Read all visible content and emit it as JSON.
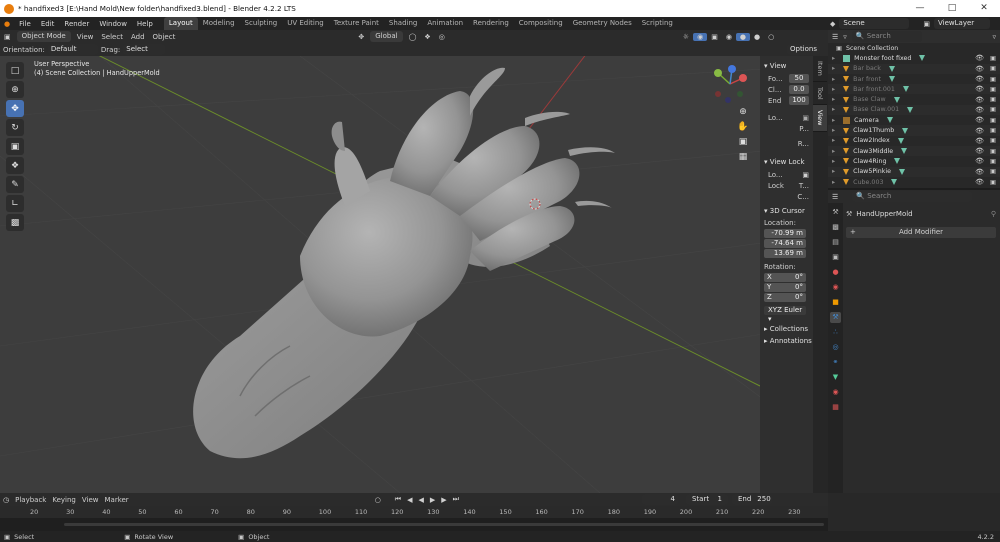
{
  "window": {
    "title": "* handfixed3 [E:\\Hand Mold\\New folder\\handfixed3.blend] - Blender 4.2.2 LTS"
  },
  "menu": [
    "File",
    "Edit",
    "Render",
    "Window",
    "Help"
  ],
  "workspaces": [
    {
      "label": "Layout",
      "active": true
    },
    {
      "label": "Modeling"
    },
    {
      "label": "Sculpting"
    },
    {
      "label": "UV Editing"
    },
    {
      "label": "Texture Paint"
    },
    {
      "label": "Shading"
    },
    {
      "label": "Animation"
    },
    {
      "label": "Rendering"
    },
    {
      "label": "Compositing"
    },
    {
      "label": "Geometry Nodes"
    },
    {
      "label": "Scripting"
    }
  ],
  "scene": {
    "name": "Scene",
    "view_layer": "ViewLayer"
  },
  "viewport_header": {
    "mode": "Object Mode",
    "menus": [
      "View",
      "Select",
      "Add",
      "Object"
    ],
    "transform": "Global",
    "options": "Options"
  },
  "tool_header": {
    "orientation_label": "Orientation:",
    "orientation": "Default",
    "drag_label": "Drag:",
    "drag": "Select Box"
  },
  "viewport": {
    "perspective": "User Perspective",
    "collection": "(4) Scene Collection | HandUpperMold"
  },
  "side_tabs": [
    "Item",
    "Tool",
    "View"
  ],
  "npanel": {
    "view_section": "View",
    "focal": {
      "label": "Fo...",
      "value": "50"
    },
    "clip_start": {
      "label": "Cl...",
      "value": "0.0"
    },
    "clip_end": {
      "label": "End",
      "value": "100"
    },
    "local_label": "Lo...",
    "p_label": "P...",
    "r_label": "R...",
    "view_lock": "View Lock",
    "lock_label": "Lo...",
    "lock2": "Lock",
    "t_label": "T...",
    "c_label": "C...",
    "cursor_section": "3D Cursor",
    "location_label": "Location:",
    "location": [
      "-70.99 m",
      "-74.64 m",
      "13.69 m"
    ],
    "rotation_label": "Rotation:",
    "rotation": [
      {
        "axis": "X",
        "value": "0°"
      },
      {
        "axis": "Y",
        "value": "0°"
      },
      {
        "axis": "Z",
        "value": "0°"
      }
    ],
    "rotation_mode": "XYZ Euler",
    "collections": "Collections",
    "annotations": "Annotations"
  },
  "outliner": {
    "search_placeholder": "Search",
    "root": "Scene Collection",
    "items": [
      {
        "name": "Monster foot fixed",
        "type": "object",
        "sel": false,
        "dim": false
      },
      {
        "name": "Bar back",
        "type": "mesh",
        "dim": true
      },
      {
        "name": "Bar front",
        "type": "mesh",
        "dim": true
      },
      {
        "name": "Bar front.001",
        "type": "mesh",
        "dim": true
      },
      {
        "name": "Base Claw",
        "type": "mesh",
        "dim": true
      },
      {
        "name": "Base Claw.001",
        "type": "mesh",
        "dim": true
      },
      {
        "name": "Camera",
        "type": "camera",
        "dim": false
      },
      {
        "name": "Claw1Thumb",
        "type": "mesh",
        "dim": false
      },
      {
        "name": "Claw2Index",
        "type": "mesh",
        "dim": false
      },
      {
        "name": "Claw3Middle",
        "type": "mesh",
        "dim": false
      },
      {
        "name": "Claw4Ring",
        "type": "mesh",
        "dim": false
      },
      {
        "name": "Claw5Pinkie",
        "type": "mesh",
        "dim": false
      },
      {
        "name": "Cube.003",
        "type": "mesh",
        "dim": true
      }
    ]
  },
  "properties": {
    "search_placeholder": "Search",
    "object": "HandUpperMold",
    "add_modifier": "Add Modifier"
  },
  "timeline": {
    "menus": [
      "Playback",
      "Keying",
      "View",
      "Marker"
    ],
    "current_frame": "4",
    "start_label": "Start",
    "start": "1",
    "end_label": "End",
    "end": "250",
    "ticks": [
      "20",
      "30",
      "40",
      "50",
      "60",
      "70",
      "80",
      "90",
      "100",
      "110",
      "120",
      "130",
      "140",
      "150",
      "160",
      "170",
      "180",
      "190",
      "200",
      "210",
      "220",
      "230"
    ]
  },
  "statusbar": {
    "select": "Select",
    "rotate": "Rotate View",
    "object": "Object",
    "version": "4.2.2"
  }
}
